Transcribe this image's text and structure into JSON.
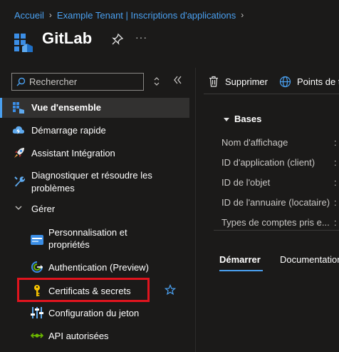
{
  "breadcrumb": {
    "home": "Accueil",
    "tenant": "Example Tenant | Inscriptions d'applications"
  },
  "header": {
    "title": "GitLab",
    "more": "···"
  },
  "search": {
    "placeholder": "Rechercher"
  },
  "nav": {
    "overview": "Vue d'ensemble",
    "quickstart": "Démarrage rapide",
    "integration": "Assistant Intégration",
    "diagnose_line1": "Diagnostiquer et résoudre les",
    "diagnose_line2": "problèmes",
    "manage": "Gérer",
    "branding_line1": "Personnalisation et",
    "branding_line2": "propriétés",
    "authentication": "Authentication (Preview)",
    "certificates": "Certificats & secrets",
    "token_config": "Configuration du jeton",
    "api_permissions": "API autorisées"
  },
  "toolbar": {
    "delete": "Supprimer",
    "endpoints": "Points de t"
  },
  "essentials": {
    "heading": "Bases",
    "props": [
      "Nom d'affichage",
      "ID d'application (client)",
      "ID de l'objet",
      "ID de l'annuaire (locataire)",
      "Types de comptes pris e..."
    ],
    "colon": ":"
  },
  "tabs": {
    "start": "Démarrer",
    "docs": "Documentation"
  },
  "colors": {
    "accent": "#4aa0f0",
    "highlight": "#e0141e",
    "background": "#1b1a19",
    "selected_bg": "#323130"
  }
}
